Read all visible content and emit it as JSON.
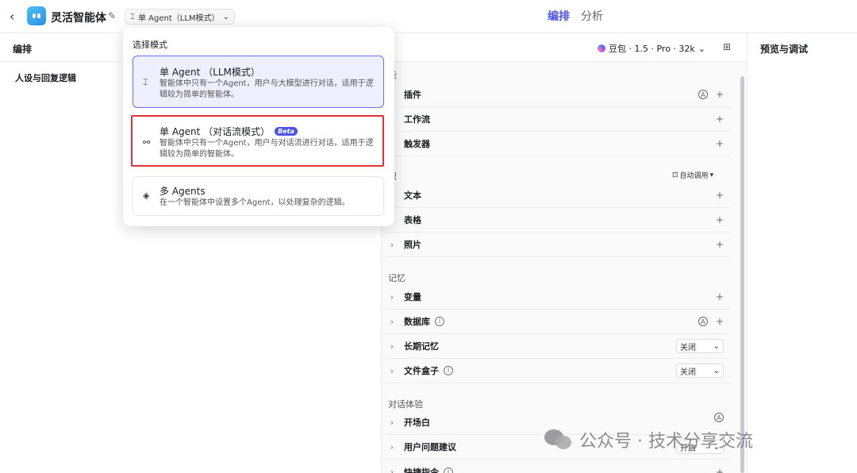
{
  "topbar": {
    "app_name": "灵活智能体",
    "mode_select": "单 Agent（LLM模式）",
    "tabs": [
      {
        "label": "编排",
        "active": true
      },
      {
        "label": "分析",
        "active": false
      }
    ]
  },
  "left": {
    "title": "编排",
    "persona": "人设与回复逻辑"
  },
  "middle": {
    "model": "豆包 · 1.5 · Pro · 32k",
    "sections": {
      "skills": "能",
      "knowledge": "识",
      "memory": "记忆",
      "dialog": "对话体验"
    },
    "auto_call": "自动调用",
    "rows": {
      "plugin": "插件",
      "workflow": "工作流",
      "trigger": "触发器",
      "text": "文本",
      "table": "表格",
      "photo": "照片",
      "variable": "变量",
      "database": "数据库",
      "long_memory": "长期记忆",
      "file_box": "文件盒子",
      "opening": "开场白",
      "suggestion": "用户问题建议",
      "shortcut": "快捷指令"
    },
    "select_off": "关闭",
    "select_on": "开启"
  },
  "right": {
    "title": "预览与调试"
  },
  "dropdown": {
    "title": "选择模式",
    "options": [
      {
        "title": "单 Agent （LLM模式）",
        "desc": "智能体中只有一个Agent，用户与大模型进行对话，适用于逻辑较为简单的智能体。"
      },
      {
        "title": "单 Agent （对话流模式）",
        "badge": "Beta",
        "desc": "智能体中只有一个Agent，用户与对话流进行对话，适用于逻辑较为简单的智能体。"
      },
      {
        "title": "多 Agents",
        "desc": "在一个智能体中设置多个Agent，以处理复杂的逻辑。"
      }
    ]
  },
  "watermark": "公众号 · 技术分享交流"
}
